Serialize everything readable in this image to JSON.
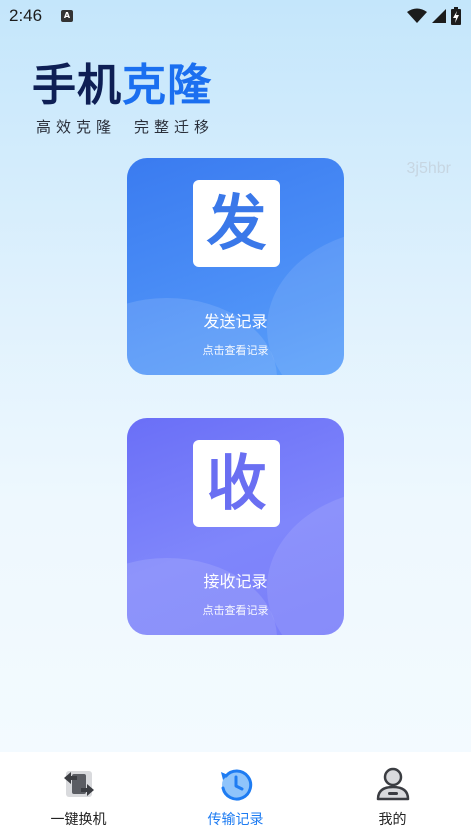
{
  "status_bar": {
    "time": "2:46",
    "notif_glyph": "A",
    "icons": [
      "wifi-icon",
      "signal-icon",
      "battery-charging-icon"
    ]
  },
  "header": {
    "title_part1": "手机",
    "title_part2": "克隆",
    "subtitle_left": "高效克隆",
    "subtitle_right": "完整迁移"
  },
  "watermark": "3j5hbr",
  "cards": {
    "send": {
      "glyph": "发",
      "title": "发送记录",
      "subtitle": "点击查看记录"
    },
    "receive": {
      "glyph": "收",
      "title": "接收记录",
      "subtitle": "点击查看记录"
    }
  },
  "bottom_nav": {
    "items": [
      {
        "label": "一键换机",
        "icon": "switch-phone-icon",
        "active": false
      },
      {
        "label": "传输记录",
        "icon": "history-icon",
        "active": true
      },
      {
        "label": "我的",
        "icon": "user-icon",
        "active": false
      }
    ]
  },
  "colors": {
    "title_dark": "#0e1f55",
    "title_accent": "#1b6ff0",
    "send_card": "#4b8ef6",
    "receive_card": "#7f86fb",
    "nav_active": "#1e7cf2"
  }
}
